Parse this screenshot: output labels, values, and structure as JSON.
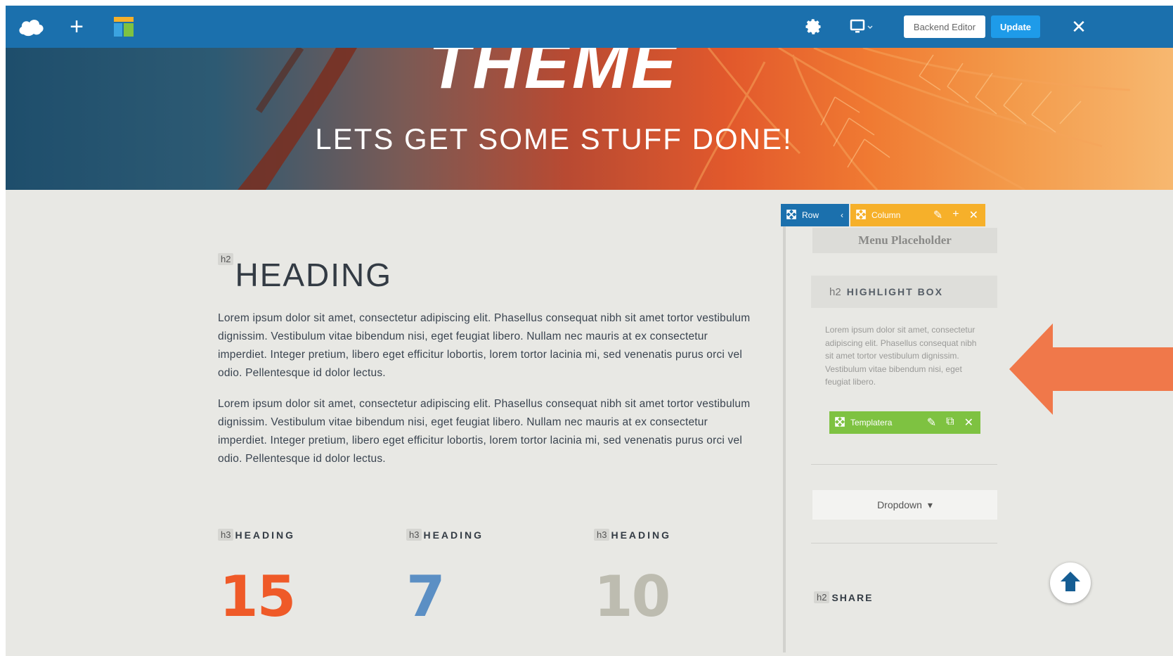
{
  "toolbar": {
    "logo_icon": "cloud-logo-icon",
    "add_icon": "plus-icon",
    "add_glyph": "+",
    "layout_icon": "layout-icon",
    "settings_icon": "gear-icon",
    "device_icon": "monitor-icon",
    "backend_editor_label": "Backend Editor",
    "update_label": "Update",
    "close_glyph": "✕",
    "color": "#1b70ad"
  },
  "hero": {
    "title": "THEME",
    "subtitle": "LETS GET SOME STUFF DONE!"
  },
  "main": {
    "h2_tag": "h2",
    "h2_title": "HEADING",
    "paragraphs": [
      "Lorem ipsum dolor sit amet, consectetur adipiscing elit. Phasellus consequat nibh sit amet tortor vestibulum dignissim. Vestibulum vitae bibendum nisi, eget feugiat libero. Nullam nec mauris at ex consectetur imperdiet. Integer pretium, libero eget efficitur lobortis, lorem tortor lacinia mi, sed venenatis purus orci vel odio. Pellentesque id dolor lectus.",
      "Lorem ipsum dolor sit amet, consectetur adipiscing elit. Phasellus consequat nibh sit amet tortor vestibulum dignissim. Vestibulum vitae bibendum nisi, eget feugiat libero. Nullam nec mauris at ex consectetur imperdiet. Integer pretium, libero eget efficitur lobortis, lorem tortor lacinia mi, sed venenatis purus orci vel odio. Pellentesque id dolor lectus."
    ],
    "columns": [
      {
        "tag": "h3",
        "title": "HEADING",
        "number": "15",
        "color": "#ef5a28"
      },
      {
        "tag": "h3",
        "title": "HEADING",
        "number": "7",
        "color": "#5b8fc4"
      },
      {
        "tag": "h3",
        "title": "HEADING",
        "number": "10",
        "color": "#bdbcb0"
      }
    ]
  },
  "sidebar": {
    "row_control": {
      "label": "Row",
      "icon": "move-icon",
      "caret": "‹",
      "color": "#1b70ad"
    },
    "column_control": {
      "label": "Column",
      "icon": "move-icon",
      "color": "#f6b02a"
    },
    "menu_placeholder": "Menu Placeholder",
    "highlight_box": {
      "tag": "h2",
      "title": "HIGHLIGHT BOX",
      "text": "Lorem ipsum dolor sit amet, consectetur adipiscing elit. Phasellus consequat nibh sit amet tortor vestibulum dignissim. Vestibulum vitae bibendum nisi, eget feugiat libero."
    },
    "templatera_control": {
      "label": "Templatera",
      "icon": "move-icon",
      "color": "#7ec241"
    },
    "dropdown": {
      "label": "Dropdown",
      "caret": "▾"
    },
    "share": {
      "tag": "h2",
      "title": "SHARE"
    }
  },
  "overlay": {
    "arrow_color": "#f0784a",
    "scroll_top_icon": "arrow-up-icon"
  }
}
